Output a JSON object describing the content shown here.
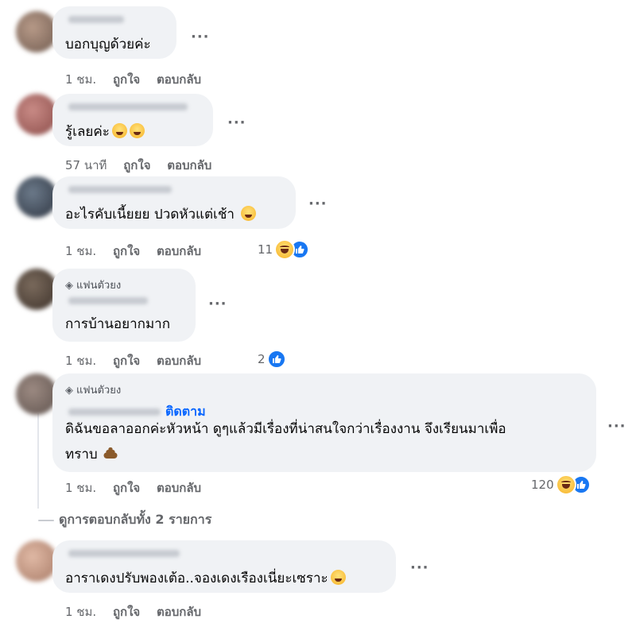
{
  "comments": [
    {
      "text": "บอกบุญด้วยค่ะ",
      "time": "1 ชม.",
      "like": "ถูกใจ",
      "reply": "ตอบกลับ"
    },
    {
      "text": "รู้เลยค่ะ",
      "time": "57 นาที",
      "like": "ถูกใจ",
      "reply": "ตอบกลับ"
    },
    {
      "text": "อะไรคับเนี้ยยย ปวดหัวแต่เช้า",
      "time": "1 ชม.",
      "like": "ถูกใจ",
      "reply": "ตอบกลับ",
      "reactions": "11"
    },
    {
      "badge": "แฟนตัวยง",
      "text": "การบ้านอยากมาก",
      "time": "1 ชม.",
      "like": "ถูกใจ",
      "reply": "ตอบกลับ",
      "reactions": "2"
    },
    {
      "badge": "แฟนตัวยง",
      "follow": "ติดตาม",
      "text_line1": "ดิฉันขอลาออกค่ะหัวหน้า ดูๆแล้วมีเรื่องที่น่าสนใจกว่าเรื่องงาน จึงเรียนมาเพื่อ",
      "text_line2": "ทราบ",
      "time": "1 ชม.",
      "like": "ถูกใจ",
      "reply": "ตอบกลับ",
      "reactions": "120"
    },
    {
      "text": "อาราเดงปรับพองเต้อ..จองเดงเรืองเนี่ยะเซราะ",
      "time": "1 ชม.",
      "like": "ถูกใจ",
      "reply": "ตอบกลับ"
    }
  ],
  "more_label": "···",
  "view_replies": "ดูการตอบกลับทั้ง 2 รายการ",
  "colors": {
    "bubble": "#f0f2f5",
    "meta": "#65676b",
    "link": "#0866ff",
    "like": "#1877f2"
  }
}
